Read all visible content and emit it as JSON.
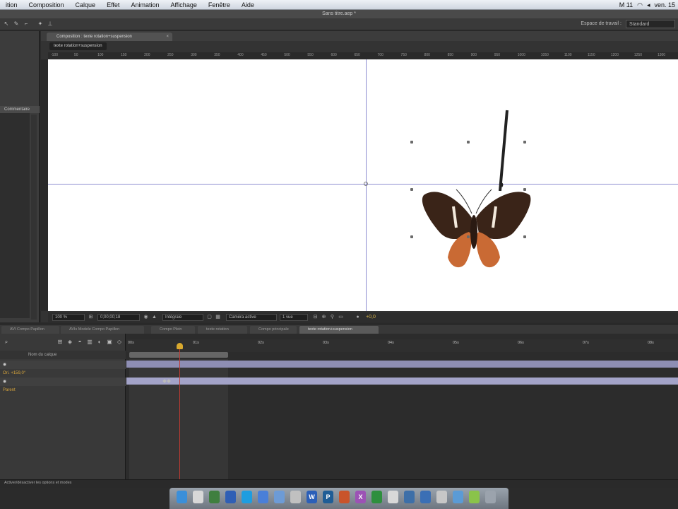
{
  "menubar": {
    "items": [
      "ition",
      "Composition",
      "Calque",
      "Effet",
      "Animation",
      "Affichage",
      "Fenêtre",
      "Aide"
    ],
    "status": "M 11",
    "clock": "ven. 15"
  },
  "window": {
    "title": "Sans titre.aep *"
  },
  "toolbar": {
    "workspace_label": "Espace de travail :",
    "workspace_value": "Standard"
  },
  "left_panel": {
    "header": "Commentaire"
  },
  "composition": {
    "tab_label": "Composition : texte rotation+suspension",
    "breadcrumb": "texte rotation+suspension",
    "ruler_labels": [
      "-100",
      "50",
      "100",
      "150",
      "200",
      "250",
      "300",
      "350",
      "400",
      "450",
      "500",
      "550",
      "600",
      "650",
      "700",
      "750",
      "800",
      "850",
      "900",
      "950",
      "1000",
      "1050",
      "1100",
      "1150",
      "1200",
      "1250",
      "1300"
    ],
    "zoom": "100 %",
    "timecode": "0;00;00;18",
    "resolution": "Intégrale",
    "camera": "Caméra active",
    "views": "1 vue",
    "exposure": "+0,0"
  },
  "timeline": {
    "tabs": [
      "AVI Compo Papillon",
      "AVIs Modele Compo Papillon",
      "Compo Plein",
      "texte rotation",
      "Compo principale",
      "texte rotation+suspension"
    ],
    "active_tab": 5,
    "layer_header": "Nom du calque",
    "prop_label": "Ori. +159,0°",
    "prop2_label": "Parent",
    "ruler_labels": [
      "00s",
      "01s",
      "02s",
      "03s",
      "04s",
      "05s",
      "06s",
      "07s",
      "08s"
    ],
    "bottom_label": "Activer/désactiver les options et modes"
  },
  "dock": {
    "icons": [
      "finder-icon",
      "compass-icon",
      "photo-icon",
      "sheet-icon",
      "skype-icon",
      "itunes-icon",
      "ical-icon",
      "mail-icon",
      "word-icon",
      "photoshop-icon",
      "powerpoint-icon",
      "excel-icon",
      "calendar-icon",
      "iphoto-icon",
      "dvd-icon",
      "preview-icon",
      "system-prefs-icon",
      "quicktime-icon",
      "messenger-icon",
      "trash-icon"
    ],
    "glyphs": [
      "",
      "",
      "",
      "",
      "",
      "",
      "",
      "",
      "W",
      "P",
      "",
      "X",
      "",
      "",
      "",
      "",
      "",
      "",
      "",
      ""
    ],
    "colors": [
      "#3b8fd9",
      "#d8d8d8",
      "#3f7f3f",
      "#2f5fb5",
      "#1e9de0",
      "#4a7fd8",
      "#6d9bd6",
      "#c0c0c0",
      "#2b5fb8",
      "#1f5d96",
      "#c9542b",
      "#9c52b5",
      "#2e8f3e",
      "#d8d8d8",
      "#3d6fa8",
      "#3b6fb5",
      "#c7c7c7",
      "#5b9bd5",
      "#8ac34a",
      "#9ba3ad"
    ]
  }
}
